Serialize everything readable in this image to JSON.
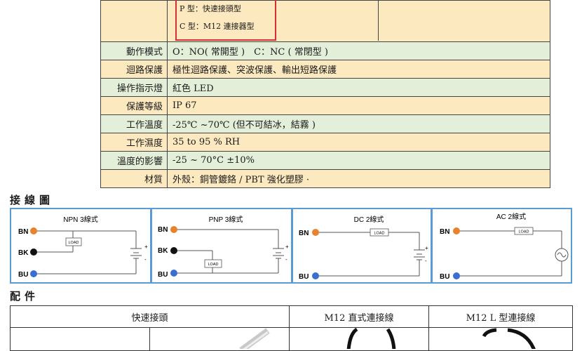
{
  "top_cell": {
    "line1": "P 型：快速接頭型",
    "line2": "C 型：M12 連接器型"
  },
  "spec_rows": [
    {
      "label": "動作模式",
      "value": "O：NO( 常開型 )　C：NC ( 常閉型 )"
    },
    {
      "label": "迴路保護",
      "value": "極性迴路保護、突波保護、輸出短路保護"
    },
    {
      "label": "操作指示燈",
      "value": "紅色 LED"
    },
    {
      "label": "保護等級",
      "value": "IP 67"
    },
    {
      "label": "工作溫度",
      "value": "-25℃ ~70℃ (但不可結冰，結霧 )"
    },
    {
      "label": "工作濕度",
      "value": "35 to 95 % RH"
    },
    {
      "label": "溫度的影響",
      "value": "-25 ~ 70°C  ±10%"
    },
    {
      "label": "材質",
      "value": "外殼：銅管鍍鉻 / PBT  強化塑膠 ·"
    }
  ],
  "wiring_section": {
    "title": "接線圖",
    "panels": [
      {
        "title": "NPN 3線式",
        "wires": [
          "BN",
          "BK",
          "BU"
        ],
        "load": "LOAD",
        "plus": "+",
        "minus": "-"
      },
      {
        "title": "PNP 3線式",
        "wires": [
          "BN",
          "BK",
          "BU"
        ],
        "load": "LOAD",
        "plus": "+",
        "minus": "-"
      },
      {
        "title": "DC 2線式",
        "wires": [
          "BN",
          "BU"
        ],
        "load": "LOAD",
        "plus": "+",
        "minus": "-"
      },
      {
        "title": "AC 2線式",
        "wires": [
          "BN",
          "BU"
        ],
        "load": "LOAD"
      }
    ],
    "colors": {
      "brown": "#e8822e",
      "black": "#111111",
      "blue": "#3a6fd1",
      "frame": "#5a9bd5"
    }
  },
  "accessories": {
    "title": "配件",
    "headers": [
      "快速接頭",
      "M12 直式連接線",
      "M12 L 型連接線"
    ]
  }
}
